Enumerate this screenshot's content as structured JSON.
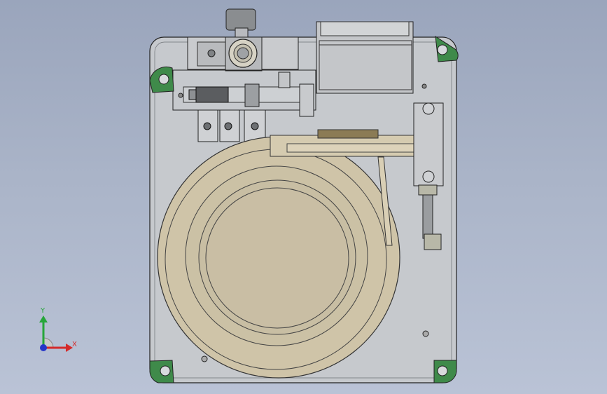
{
  "viewport": {
    "background_top": "#9aa5bc",
    "background_bottom": "#bac3d6"
  },
  "model": {
    "plate_color": "#c6c9cd",
    "bowl_color": "#cfc4a8",
    "bowl_inner_color": "#c9bea4",
    "corner_mount_color": "#3f8a4a",
    "edge_color": "#222222"
  },
  "triad": {
    "x_label": "X",
    "y_label": "Y",
    "x_color": "#d42a2a",
    "y_color": "#26a63a",
    "z_color": "#2636c8"
  }
}
